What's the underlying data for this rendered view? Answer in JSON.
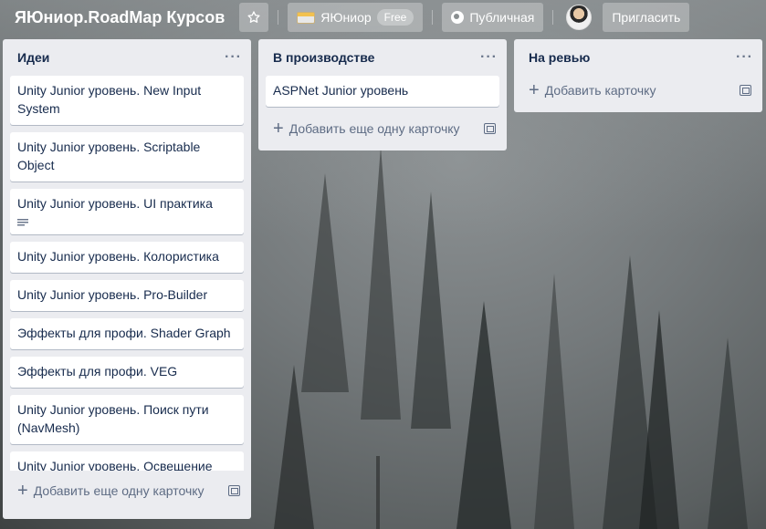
{
  "header": {
    "board_title": "ЯЮниор.RoadMap Курсов",
    "team_name": "ЯЮниор",
    "team_badge": "Free",
    "visibility": "Публичная",
    "invite_label": "Пригласить",
    "star_icon": "star-icon"
  },
  "lists": [
    {
      "title": "Идеи",
      "menu": "···",
      "cards": [
        "Unity Junior уровень. New Input System",
        "Unity Junior уровень. Scriptable Object",
        "Unity Junior уровень. UI практика",
        "Unity Junior уровень. Колористика",
        "Unity Junior уровень. Pro-Builder",
        "Эффекты для профи. Shader Graph",
        "Эффекты для профи. VEG",
        "Unity Junior уровень. Поиск пути (NavMesh)",
        "Unity Junior уровень. Освещение"
      ],
      "add_label": "Добавить еще одну карточку"
    },
    {
      "title": "В производстве",
      "menu": "···",
      "cards": [
        "ASPNet Junior уровень"
      ],
      "add_label": "Добавить еще одну карточку"
    },
    {
      "title": "На ревью",
      "menu": "···",
      "cards": [],
      "add_label": "Добавить карточку"
    }
  ],
  "colors": {
    "list_bg": "#ebecf0",
    "card_bg": "#ffffff",
    "text": "#172b4d",
    "muted": "#5e6c84"
  }
}
